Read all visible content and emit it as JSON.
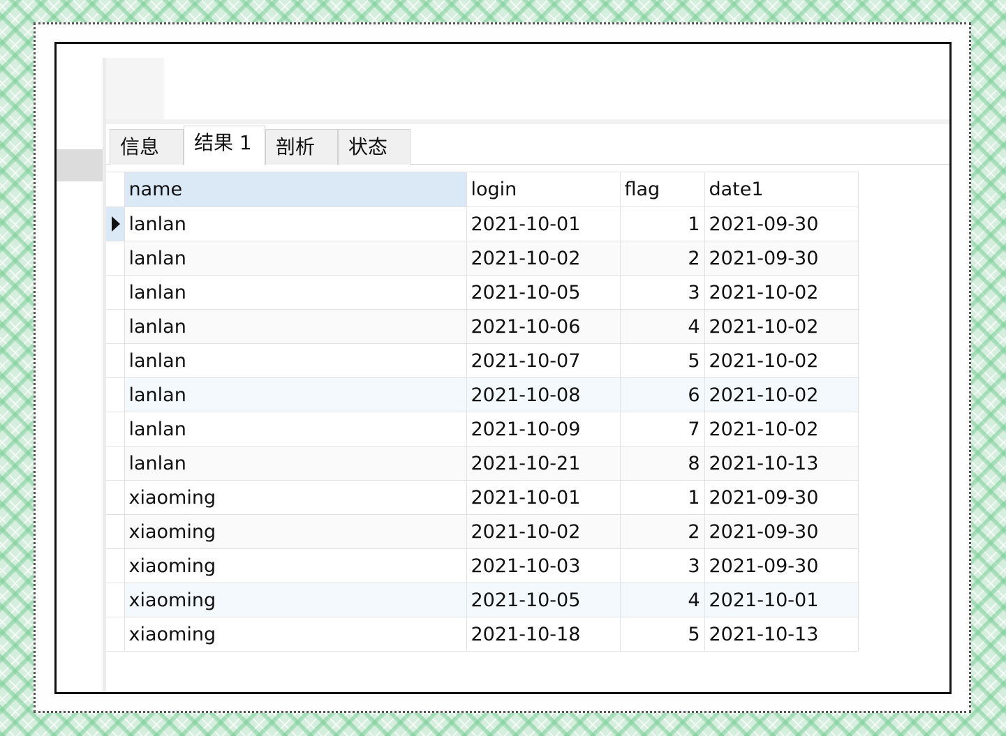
{
  "tabs": [
    {
      "label": "信息"
    },
    {
      "label": "结果 1"
    },
    {
      "label": "剖析"
    },
    {
      "label": "状态"
    }
  ],
  "active_tab": 1,
  "columns": [
    "name",
    "login",
    "flag",
    "date1"
  ],
  "rows": [
    {
      "name": "lanlan",
      "login": "2021-10-01",
      "flag": "1",
      "date1": "2021-09-30"
    },
    {
      "name": "lanlan",
      "login": "2021-10-02",
      "flag": "2",
      "date1": "2021-09-30"
    },
    {
      "name": "lanlan",
      "login": "2021-10-05",
      "flag": "3",
      "date1": "2021-10-02"
    },
    {
      "name": "lanlan",
      "login": "2021-10-06",
      "flag": "4",
      "date1": "2021-10-02"
    },
    {
      "name": "lanlan",
      "login": "2021-10-07",
      "flag": "5",
      "date1": "2021-10-02"
    },
    {
      "name": "lanlan",
      "login": "2021-10-08",
      "flag": "6",
      "date1": "2021-10-02"
    },
    {
      "name": "lanlan",
      "login": "2021-10-09",
      "flag": "7",
      "date1": "2021-10-02"
    },
    {
      "name": "lanlan",
      "login": "2021-10-21",
      "flag": "8",
      "date1": "2021-10-13"
    },
    {
      "name": "xiaoming",
      "login": "2021-10-01",
      "flag": "1",
      "date1": "2021-09-30"
    },
    {
      "name": "xiaoming",
      "login": "2021-10-02",
      "flag": "2",
      "date1": "2021-09-30"
    },
    {
      "name": "xiaoming",
      "login": "2021-10-03",
      "flag": "3",
      "date1": "2021-09-30"
    },
    {
      "name": "xiaoming",
      "login": "2021-10-05",
      "flag": "4",
      "date1": "2021-10-01"
    },
    {
      "name": "xiaoming",
      "login": "2021-10-18",
      "flag": "5",
      "date1": "2021-10-13"
    }
  ],
  "current_row_icon": "row-pointer-icon"
}
